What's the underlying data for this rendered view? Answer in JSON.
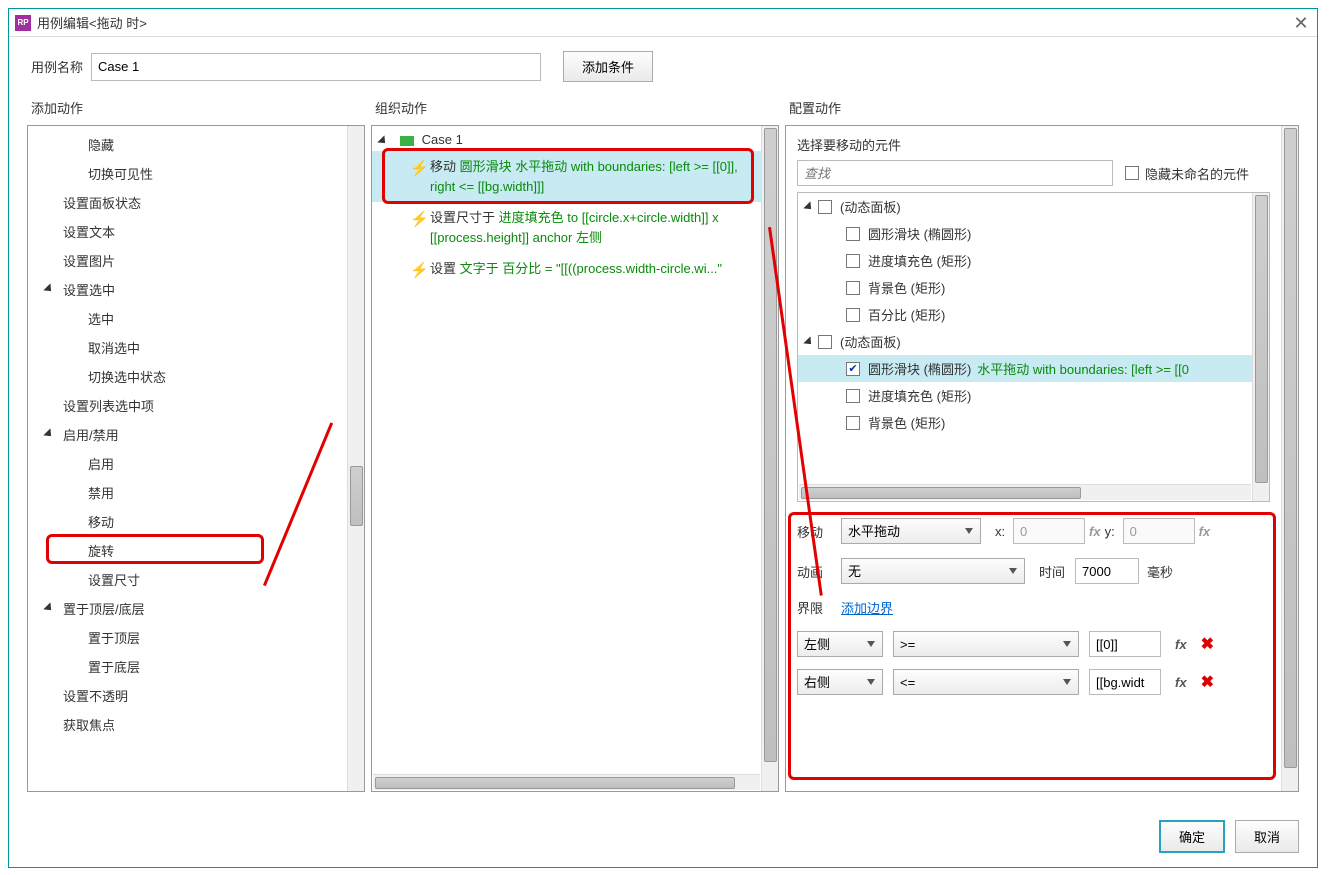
{
  "window": {
    "title": "用例编辑<拖动 时>"
  },
  "labels": {
    "case_name": "用例名称",
    "add_condition": "添加条件",
    "add_action_col": "添加动作",
    "organize_col": "组织动作",
    "configure_col": "配置动作"
  },
  "case_name_value": "Case 1",
  "action_tree": {
    "items": [
      {
        "t": "item",
        "label": "隐藏"
      },
      {
        "t": "item",
        "label": "切换可见性"
      },
      {
        "t": "grp",
        "label": "设置面板状态",
        "indent": "grp"
      },
      {
        "t": "grp",
        "label": "设置文本",
        "indent": "grp"
      },
      {
        "t": "grp",
        "label": "设置图片",
        "indent": "grp"
      },
      {
        "t": "grp",
        "label": "设置选中",
        "tw": true
      },
      {
        "t": "item",
        "label": "选中"
      },
      {
        "t": "item",
        "label": "取消选中"
      },
      {
        "t": "item",
        "label": "切换选中状态"
      },
      {
        "t": "grp",
        "label": "设置列表选中项",
        "indent": "grp"
      },
      {
        "t": "grp",
        "label": "启用/禁用",
        "tw": true
      },
      {
        "t": "item",
        "label": "启用"
      },
      {
        "t": "item",
        "label": "禁用"
      },
      {
        "t": "item",
        "label": "移动",
        "hl": true
      },
      {
        "t": "item",
        "label": "旋转"
      },
      {
        "t": "item",
        "label": "设置尺寸"
      },
      {
        "t": "grp",
        "label": "置于顶层/底层",
        "tw": true
      },
      {
        "t": "item",
        "label": "置于顶层"
      },
      {
        "t": "item",
        "label": "置于底层"
      },
      {
        "t": "grp",
        "label": "设置不透明",
        "indent": "grp"
      },
      {
        "t": "grp",
        "label": "获取焦点",
        "indent": "grp"
      }
    ]
  },
  "organize": {
    "case_label": "Case 1",
    "actions": [
      {
        "plain": "移动 ",
        "green": "圆形滑块 水平拖动 with boundaries: [left >= [[0]], right <= [[bg.width]]]",
        "selected": true
      },
      {
        "plain": "设置尺寸于 ",
        "green": "进度填充色 to [[circle.x+circle.width]] x [[process.height]] anchor 左侧"
      },
      {
        "plain": "设置 ",
        "green": "文字于 百分比 = \"[[((process.width-circle.wi...\""
      }
    ]
  },
  "configure": {
    "head": "选择要移动的元件",
    "search_ph": "查找",
    "hide_unnamed": "隐藏未命名的元件",
    "tree": [
      {
        "ind": 0,
        "tw": true,
        "chk": false,
        "label": "(动态面板)"
      },
      {
        "ind": 1,
        "tw": false,
        "chk": false,
        "label": "圆形滑块 (椭圆形)"
      },
      {
        "ind": 1,
        "tw": false,
        "chk": false,
        "label": "进度填充色 (矩形)"
      },
      {
        "ind": 1,
        "tw": false,
        "chk": false,
        "label": "背景色 (矩形)"
      },
      {
        "ind": 1,
        "tw": false,
        "chk": false,
        "label": "百分比 (矩形)"
      },
      {
        "ind": 0,
        "tw": true,
        "chk": false,
        "label": "(动态面板)"
      },
      {
        "ind": 1,
        "tw": false,
        "chk": true,
        "label": "圆形滑块 (椭圆形)",
        "extra": "水平拖动 with boundaries: [left >= [[0",
        "selected": true
      },
      {
        "ind": 1,
        "tw": false,
        "chk": false,
        "label": "进度填充色 (矩形)"
      },
      {
        "ind": 1,
        "tw": false,
        "chk": false,
        "label": "背景色 (矩形)"
      }
    ],
    "form": {
      "move_label": "移动",
      "move_value": "水平拖动",
      "x_label": "x:",
      "x_value": "0",
      "y_label": "y:",
      "y_value": "0",
      "anim_label": "动画",
      "anim_value": "无",
      "time_label": "时间",
      "time_value": "7000",
      "time_unit": "毫秒",
      "bound_label": "界限",
      "add_bound": "添加边界",
      "bounds": [
        {
          "side": "左侧",
          "op": ">=",
          "val": "[[0]]"
        },
        {
          "side": "右侧",
          "op": "<=",
          "val": "[[bg.widt"
        }
      ],
      "fx": "fx"
    }
  },
  "footer": {
    "ok": "确定",
    "cancel": "取消"
  }
}
